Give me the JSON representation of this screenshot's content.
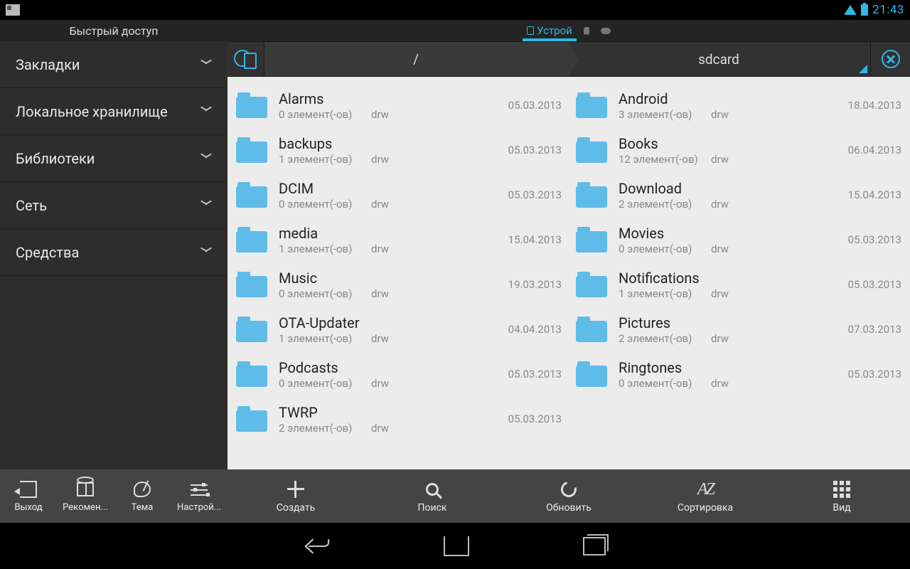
{
  "status": {
    "time": "21:43"
  },
  "top": {
    "quick_access": "Быстрый доступ",
    "tab_device": "Устрой"
  },
  "sidebar": {
    "items": [
      {
        "label": "Закладки"
      },
      {
        "label": "Локальное хранилище"
      },
      {
        "label": "Библиотеки"
      },
      {
        "label": "Сеть"
      },
      {
        "label": "Средства"
      }
    ]
  },
  "path": {
    "root": "/",
    "current": "sdcard"
  },
  "files_left": [
    {
      "name": "Alarms",
      "count": "0 элемент(-ов)",
      "perms": "drw",
      "date": "05.03.2013"
    },
    {
      "name": "backups",
      "count": "1 элемент(-ов)",
      "perms": "drw",
      "date": "05.03.2013"
    },
    {
      "name": "DCIM",
      "count": "0 элемент(-ов)",
      "perms": "drw",
      "date": "05.03.2013"
    },
    {
      "name": "media",
      "count": "1 элемент(-ов)",
      "perms": "drw",
      "date": "15.04.2013"
    },
    {
      "name": "Music",
      "count": "0 элемент(-ов)",
      "perms": "drw",
      "date": "19.03.2013"
    },
    {
      "name": "OTA-Updater",
      "count": "1 элемент(-ов)",
      "perms": "drw",
      "date": "04.04.2013"
    },
    {
      "name": "Podcasts",
      "count": "0 элемент(-ов)",
      "perms": "drw",
      "date": "05.03.2013"
    },
    {
      "name": "TWRP",
      "count": "2 элемент(-ов)",
      "perms": "drw",
      "date": "05.03.2013"
    }
  ],
  "files_right": [
    {
      "name": "Android",
      "count": "3 элемент(-ов)",
      "perms": "drw",
      "date": "18.04.2013"
    },
    {
      "name": "Books",
      "count": "12 элемент(-ов)",
      "perms": "drw",
      "date": "06.04.2013"
    },
    {
      "name": "Download",
      "count": "2 элемент(-ов)",
      "perms": "drw",
      "date": "15.04.2013"
    },
    {
      "name": "Movies",
      "count": "0 элемент(-ов)",
      "perms": "drw",
      "date": "05.03.2013"
    },
    {
      "name": "Notifications",
      "count": "1 элемент(-ов)",
      "perms": "drw",
      "date": "05.03.2013"
    },
    {
      "name": "Pictures",
      "count": "2 элемент(-ов)",
      "perms": "drw",
      "date": "07.03.2013"
    },
    {
      "name": "Ringtones",
      "count": "0 элемент(-ов)",
      "perms": "drw",
      "date": "05.03.2013"
    }
  ],
  "bottom_left": [
    {
      "label": "Выход"
    },
    {
      "label": "Рекомен..."
    },
    {
      "label": "Тема"
    },
    {
      "label": "Настрой..."
    }
  ],
  "bottom_right": [
    {
      "label": "Создать"
    },
    {
      "label": "Поиск"
    },
    {
      "label": "Обновить"
    },
    {
      "label": "Сортировка"
    },
    {
      "label": "Вид"
    }
  ]
}
